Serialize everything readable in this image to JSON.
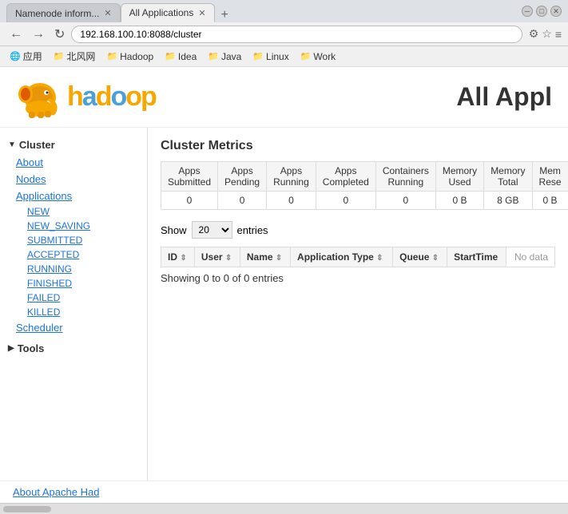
{
  "browser": {
    "tabs": [
      {
        "label": "Namenode inform...",
        "active": false,
        "closable": true
      },
      {
        "label": "All Applications",
        "active": true,
        "closable": true
      }
    ],
    "address": "192.168.100.10:8088/cluster",
    "bookmarks": [
      {
        "icon": "🌐",
        "label": "应用"
      },
      {
        "icon": "📁",
        "label": "北风网"
      },
      {
        "icon": "📁",
        "label": "Hadoop"
      },
      {
        "icon": "📁",
        "label": "Idea"
      },
      {
        "icon": "📁",
        "label": "Java"
      },
      {
        "icon": "📁",
        "label": "Linux"
      },
      {
        "icon": "📁",
        "label": "Work"
      }
    ]
  },
  "page": {
    "title": "All Appl",
    "logo_text": "hadoop"
  },
  "sidebar": {
    "cluster_label": "Cluster",
    "about_label": "About",
    "nodes_label": "Nodes",
    "applications_label": "Applications",
    "sub_links": [
      "NEW",
      "NEW_SAVING",
      "SUBMITTED",
      "ACCEPTED",
      "RUNNING",
      "FINISHED",
      "FAILED",
      "KILLED"
    ],
    "scheduler_label": "Scheduler",
    "tools_label": "Tools"
  },
  "metrics": {
    "section_title": "Cluster Metrics",
    "show_label": "Show",
    "entries_label": "entries",
    "entries_value": "20",
    "columns": [
      "Apps Submitted",
      "Apps Pending",
      "Apps Running",
      "Apps Completed",
      "Containers Running",
      "Memory Used",
      "Memory Total",
      "Mem Reserve"
    ],
    "values": [
      "0",
      "0",
      "0",
      "0",
      "0",
      "0 B",
      "8 GB",
      "0 B"
    ]
  },
  "table": {
    "headers": [
      "ID",
      "User",
      "Name",
      "Application Type",
      "Queue",
      "StartTime"
    ],
    "no_data_label": "No data",
    "showing_label": "Showing 0 to 0 of 0 entries"
  },
  "footer": {
    "label": "About Apache Had"
  }
}
